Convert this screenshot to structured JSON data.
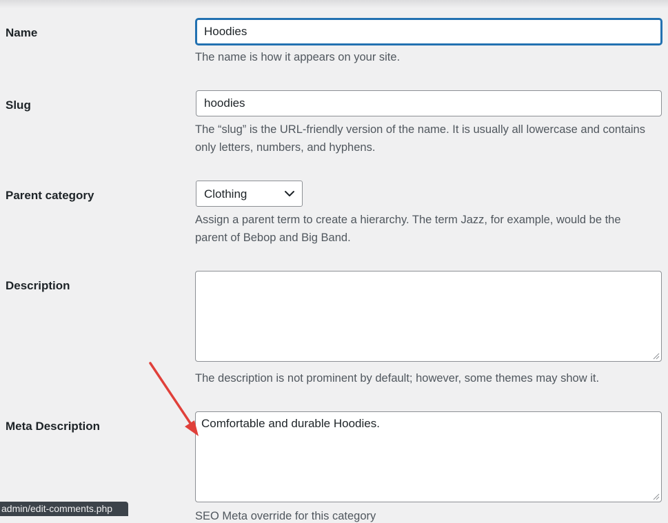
{
  "form": {
    "name": {
      "label": "Name",
      "value": "Hoodies",
      "help": "The name is how it appears on your site."
    },
    "slug": {
      "label": "Slug",
      "value": "hoodies",
      "help": "The “slug” is the URL-friendly version of the name. It is usually all lowercase and contains only letters, numbers, and hyphens."
    },
    "parent": {
      "label": "Parent category",
      "selected": "Clothing",
      "help": "Assign a parent term to create a hierarchy. The term Jazz, for example, would be the parent of Bebop and Big Band."
    },
    "description": {
      "label": "Description",
      "value": "",
      "help": "The description is not prominent by default; however, some themes may show it."
    },
    "meta_description": {
      "label": "Meta Description",
      "value": "Comfortable and durable Hoodies.",
      "help_partial": "SEO Meta override for this category"
    }
  },
  "status_bar": {
    "url": "admin/edit-comments.php"
  },
  "colors": {
    "background": "#f0f0f1",
    "focus": "#2271b1",
    "arrow": "#e0403a"
  },
  "icons": {
    "select_chevron": "chevron-down-icon",
    "arrow": "annotation-arrow-icon"
  }
}
